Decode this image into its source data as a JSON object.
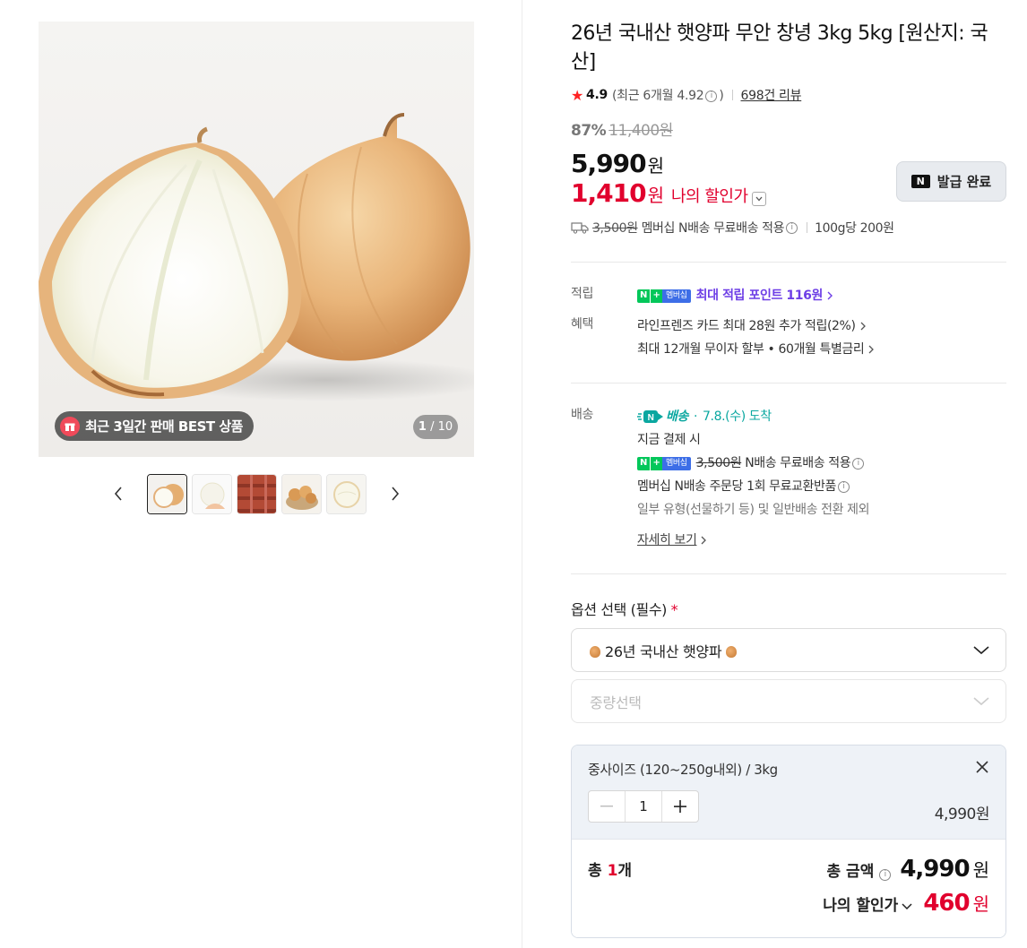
{
  "gallery": {
    "best_badge": "최근 3일간 판매 BEST 상품",
    "current_index": "1",
    "total_count": "/ 10",
    "thumbnails": [
      "onion-halved",
      "onion-peeled",
      "onion-sacks",
      "onion-basket",
      "onion-cut"
    ]
  },
  "product": {
    "title": "26년 국내산 햇양파 무안 창녕 3kg 5kg [원산지: 국산]",
    "rating": "4.9",
    "recent_rating": "(최근 6개월 4.92",
    "recent_rating_close": ")",
    "review_count": "698건 리뷰",
    "discount_pct": "87%",
    "original_price": "11,400원",
    "price": "5,990",
    "currency": "원",
    "my_price": "1,410",
    "my_price_label": "나의 할인가",
    "coupon_button": "발급 완료",
    "coupon_logo": "N",
    "shipping_fee_strike": "3,500원",
    "shipping_text": "멤버십 N배송 무료배송 적용",
    "unit_price": "100g당 200원"
  },
  "benefits": {
    "points_label": "적립",
    "points_text": "최대 적립 포인트 116원",
    "benefit_label": "혜택",
    "benefit_line1": "라인프렌즈 카드 최대 28원 추가 적립(2%)",
    "benefit_line2": "최대 12개월 무이자 할부 • 60개월 특별금리"
  },
  "delivery": {
    "label": "배송",
    "badge": "배송",
    "badge_dot": "·",
    "arrival": "7.8.(수) 도착",
    "line1": "지금 결제 시",
    "free_strike": "3,500원",
    "free_text": "N배송 무료배송 적용",
    "exchange": "멤버십 N배송 주문당 1회 무료교환반품",
    "exclusion": "일부 유형(선물하기 등) 및 일반배송 전환 제외",
    "details_link": "자세히 보기",
    "membership_badge": "멤버십",
    "n_badge": "N",
    "plus_badge": "+"
  },
  "options": {
    "title": "옵션 선택 (필수)",
    "required_mark": "*",
    "select1": "26년 국내산 햇양파",
    "select2_placeholder": "중량선택"
  },
  "cart": {
    "option_text": "중사이즈 (120~250g내외) / 3kg",
    "quantity": "1",
    "item_price": "4,990원",
    "total_qty_label": "총 ",
    "total_qty": "1",
    "total_qty_unit": "개",
    "total_amount_label": "총 금액",
    "total_amount": "4,990",
    "my_price_label": "나의 할인가",
    "my_price": "460",
    "currency": "원"
  }
}
